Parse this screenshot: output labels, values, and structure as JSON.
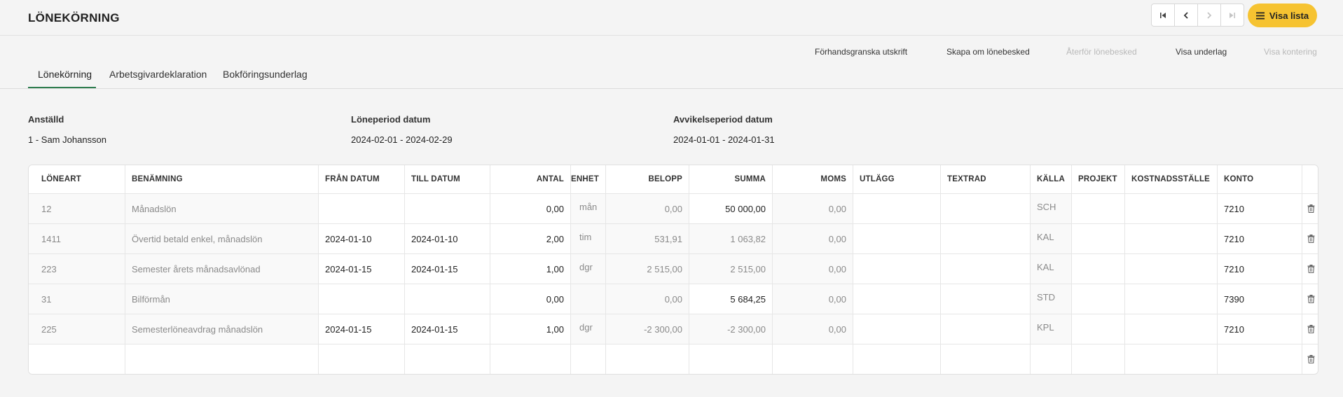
{
  "header": {
    "title": "LÖNEKÖRNING",
    "visa_lista": "Visa lista"
  },
  "actions": [
    {
      "label": "Förhandsgranska utskrift",
      "enabled": true
    },
    {
      "label": "Skapa om lönebesked",
      "enabled": true
    },
    {
      "label": "Återför lönebesked",
      "enabled": false
    },
    {
      "label": "Visa underlag",
      "enabled": true
    },
    {
      "label": "Visa kontering",
      "enabled": false
    }
  ],
  "tabs": [
    {
      "label": "Lönekörning",
      "active": true
    },
    {
      "label": "Arbetsgivardeklaration",
      "active": false
    },
    {
      "label": "Bokföringsunderlag",
      "active": false
    }
  ],
  "info": {
    "employee_label": "Anställd",
    "employee_value": "1 - Sam Johansson",
    "period_label": "Löneperiod datum",
    "period_value": "2024-02-01 - 2024-02-29",
    "deviation_label": "Avvikelseperiod datum",
    "deviation_value": "2024-01-01 - 2024-01-31"
  },
  "table": {
    "columns": [
      "LÖNEART",
      "BENÄMNING",
      "FRÅN DATUM",
      "TILL DATUM",
      "ANTAL",
      "ENHET",
      "BELOPP",
      "SUMMA",
      "MOMS",
      "UTLÄGG",
      "TEXTRAD",
      "KÄLLA",
      "PROJEKT",
      "KOSTNADSSTÄLLE",
      "KONTO"
    ],
    "rows": [
      {
        "loneart": "12",
        "benamning": "Månadslön",
        "fran": "",
        "till": "",
        "antal": "0,00",
        "enhet": "mån",
        "belopp": "0,00",
        "summa": "50 000,00",
        "moms": "0,00",
        "utlagg": "",
        "textrad": "",
        "kalla": "SCH",
        "projekt": "",
        "kostnadsstalle": "",
        "konto": "7210"
      },
      {
        "loneart": "1411",
        "benamning": "Övertid betald enkel, månadslön",
        "fran": "2024-01-10",
        "till": "2024-01-10",
        "antal": "2,00",
        "enhet": "tim",
        "belopp": "531,91",
        "summa": "1 063,82",
        "moms": "0,00",
        "utlagg": "",
        "textrad": "",
        "kalla": "KAL",
        "projekt": "",
        "kostnadsstalle": "",
        "konto": "7210"
      },
      {
        "loneart": "223",
        "benamning": "Semester årets månadsavlönad",
        "fran": "2024-01-15",
        "till": "2024-01-15",
        "antal": "1,00",
        "enhet": "dgr",
        "belopp": "2 515,00",
        "summa": "2 515,00",
        "moms": "0,00",
        "utlagg": "",
        "textrad": "",
        "kalla": "KAL",
        "projekt": "",
        "kostnadsstalle": "",
        "konto": "7210"
      },
      {
        "loneart": "31",
        "benamning": "Bilförmån",
        "fran": "",
        "till": "",
        "antal": "0,00",
        "enhet": "",
        "belopp": "0,00",
        "summa": "5 684,25",
        "moms": "0,00",
        "utlagg": "",
        "textrad": "",
        "kalla": "STD",
        "projekt": "",
        "kostnadsstalle": "",
        "konto": "7390"
      },
      {
        "loneart": "225",
        "benamning": "Semesterlöneavdrag månadslön",
        "fran": "2024-01-15",
        "till": "2024-01-15",
        "antal": "1,00",
        "enhet": "dgr",
        "belopp": "-2 300,00",
        "summa": "-2 300,00",
        "moms": "0,00",
        "utlagg": "",
        "textrad": "",
        "kalla": "KPL",
        "projekt": "",
        "kostnadsstalle": "",
        "konto": "7210"
      },
      {
        "loneart": "",
        "benamning": "",
        "fran": "",
        "till": "",
        "antal": "",
        "enhet": "",
        "belopp": "",
        "summa": "",
        "moms": "",
        "utlagg": "",
        "textrad": "",
        "kalla": "",
        "projekt": "",
        "kostnadsstalle": "",
        "konto": ""
      }
    ]
  },
  "icons": {
    "first": "first-page-icon",
    "prev": "chevron-left-icon",
    "next": "chevron-right-icon",
    "last": "last-page-icon",
    "list": "list-icon",
    "delete": "trash-icon"
  },
  "colors": {
    "accent": "#f6c331",
    "tab_active": "#2e7d4f"
  }
}
